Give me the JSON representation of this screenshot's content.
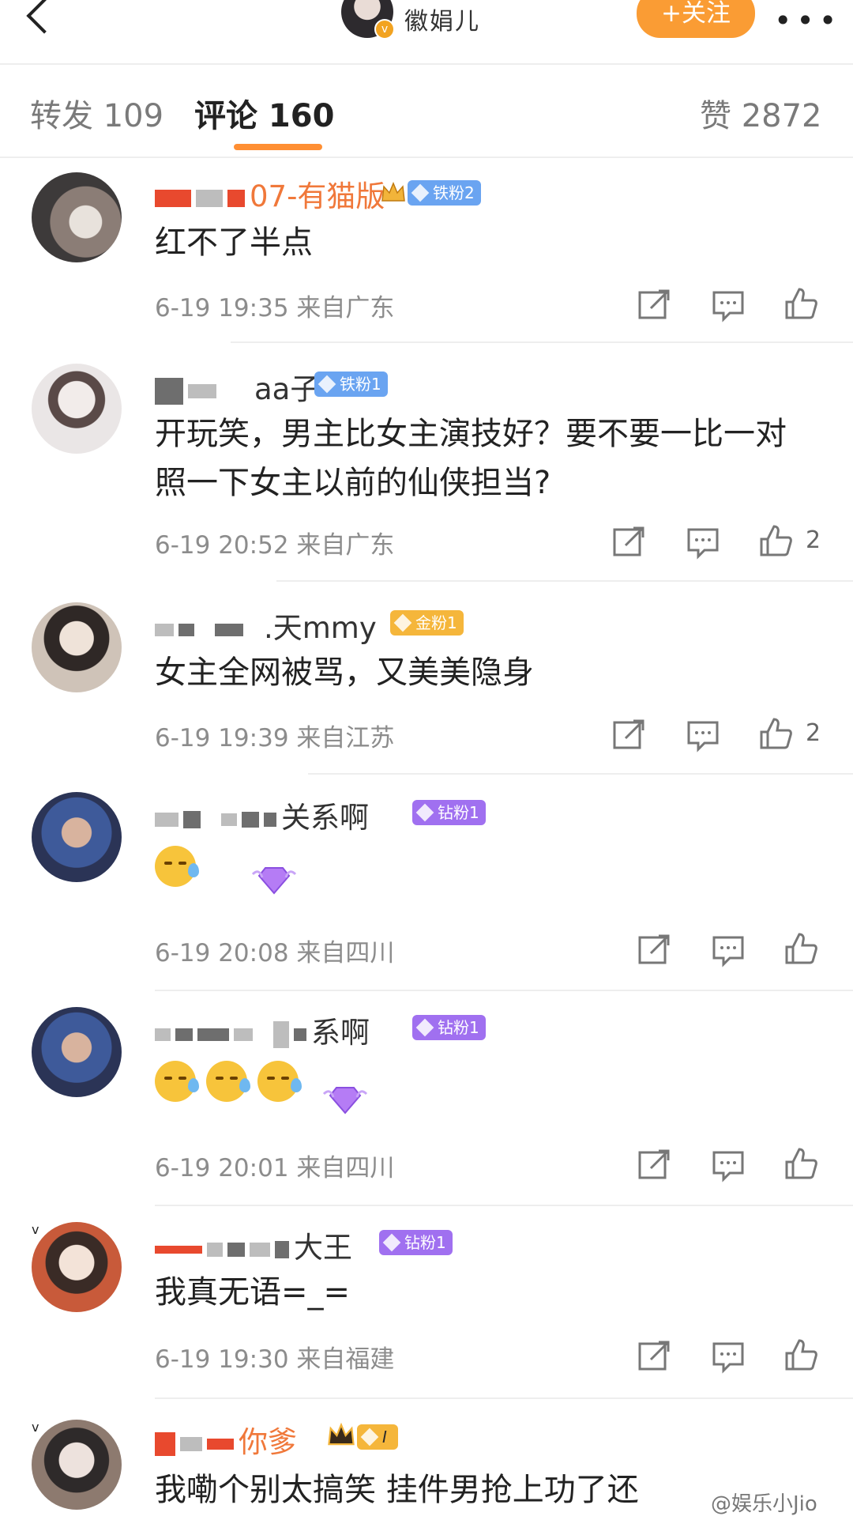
{
  "header": {
    "back_icon": "chevron-left-icon",
    "author_name": "徽娟儿",
    "follow_label": "+关注",
    "more_label": "•••"
  },
  "tabs": {
    "repost": "转发 109",
    "comments": "评论 160",
    "likes": "赞 2872"
  },
  "comments": [
    {
      "name": "07-有猫版",
      "fan_badge": "铁粉2",
      "text": "红不了半点",
      "meta": "6-19 19:35  来自广东",
      "likes": ""
    },
    {
      "name": "aa子",
      "fan_badge": "铁粉1",
      "text": "开玩笑，男主比女主演技好？要不要一比一对照一下女主以前的仙侠担当?",
      "meta": "6-19 20:52  来自广东",
      "likes": "2"
    },
    {
      "name": ".天mmy",
      "fan_badge": "金粉1",
      "text": "女主全网被骂，又美美隐身",
      "meta": "6-19 19:39  来自江苏",
      "likes": "2"
    },
    {
      "name": "关系啊",
      "fan_badge": "钻粉1",
      "text": "",
      "meta": "6-19 20:08  来自四川",
      "likes": ""
    },
    {
      "name": "系啊",
      "fan_badge": "钻粉1",
      "text": "",
      "meta": "6-19 20:01  来自四川",
      "likes": ""
    },
    {
      "name": "大王",
      "fan_badge": "钻粉1",
      "text": "我真无语=_=",
      "meta": "6-19 19:30  来自福建",
      "likes": ""
    },
    {
      "name": "你爹",
      "fan_badge": "I",
      "text": "我嘞个别太搞笑 挂件男抢上功了还",
      "meta": "",
      "likes": ""
    }
  ],
  "watermark": "@娱乐小Jio",
  "colors": {
    "accent": "#fa9c34",
    "iron_fan": "#6aa4f1",
    "gold_fan": "#f5b63b",
    "diamond_fan": "#a070f0"
  }
}
